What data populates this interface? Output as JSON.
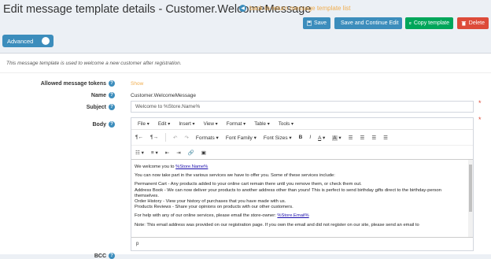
{
  "page": {
    "title": "Edit message template details - Customer.WelcomeMessage",
    "back_link": "back to return message template list"
  },
  "toolbar": {
    "save": "Save",
    "save_continue": "Save and Continue Edit",
    "copy": "Copy template",
    "delete": "Delete"
  },
  "mode": {
    "label": "Advanced"
  },
  "info": "This message template is used to welcome a new customer after registration.",
  "fields": {
    "tokens_label": "Allowed message tokens",
    "tokens_value": "Show",
    "name_label": "Name",
    "name_value": "Customer.WelcomeMessage",
    "subject_label": "Subject",
    "subject_value": "Welcome to %Store.Name%",
    "body_label": "Body",
    "bcc_label": "BCC"
  },
  "editor": {
    "menu": [
      "File",
      "Edit",
      "Insert",
      "View",
      "Format",
      "Table",
      "Tools"
    ],
    "formats": "Formats",
    "font_family": "Font Family",
    "font_sizes": "Font Sizes",
    "content": {
      "l1a": "We welcome you to ",
      "l1b": "%Store.Name%",
      "l2": "You can now take part in the various services we have to offer you. Some of these services include:",
      "l3": "Permanent Cart - Any products added to your online cart remain there until you remove them, or check them out.",
      "l4": "Address Book - We can now deliver your products to another address other than yours! This is perfect to send birthday gifts direct to the birthday-person themselves.",
      "l5": "Order History - View your history of purchases that you have made with us.",
      "l6": "Products Reviews - Share your opinions on products with our other customers.",
      "l7a": "For help with any of our online services, please email the store-owner: ",
      "l7b": "%Store.Email%",
      "l8": "Note: This email address was provided on our registration page. If you own the email and did not register on our site, please send an email to"
    },
    "status": "p"
  },
  "colors": {
    "primary": "#3c8dbc",
    "success": "#00a65a",
    "danger": "#dd4b39",
    "warning": "#f0ad4e"
  }
}
